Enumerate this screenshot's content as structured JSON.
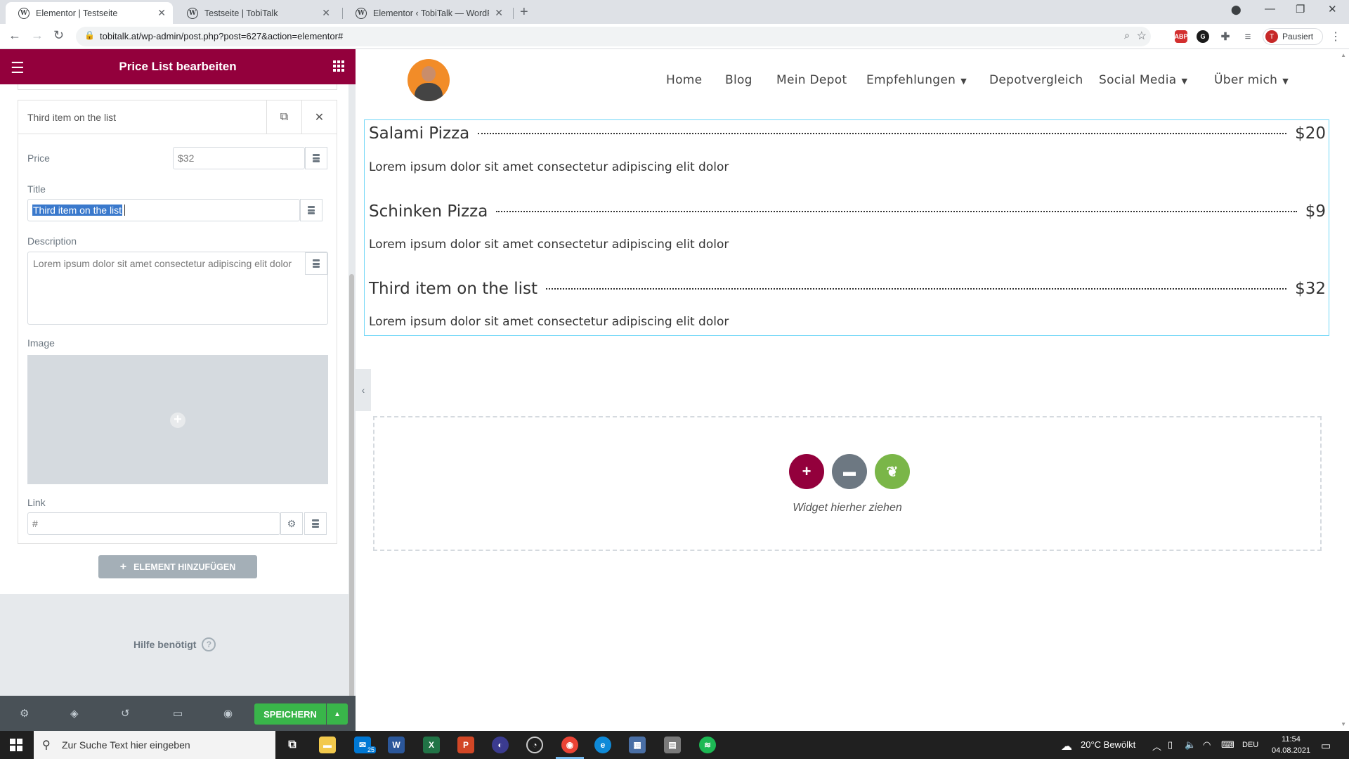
{
  "browser": {
    "tabs": [
      {
        "label": "Elementor | Testseite",
        "active": true
      },
      {
        "label": "Testseite | TobiTalk",
        "active": false
      },
      {
        "label": "Elementor ‹ TobiTalk — WordPre",
        "active": false
      }
    ],
    "url": "tobitalk.at/wp-admin/post.php?post=627&action=elementor#",
    "profile_label": "Pausiert",
    "profile_initial": "T",
    "ext_abp": "ABP"
  },
  "panel": {
    "title": "Price List bearbeiten",
    "item_title": "Third item on the list",
    "fields": {
      "price_label": "Price",
      "price_value": "$32",
      "title_label": "Title",
      "title_value": "Third item on the list",
      "description_label": "Description",
      "description_value": "Lorem ipsum dolor sit amet consectetur adipiscing elit dolor",
      "image_label": "Image",
      "link_label": "Link",
      "link_placeholder": "#"
    },
    "add_button": "ELEMENT HINZUFÜGEN",
    "help": "Hilfe benötigt",
    "save_button": "SPEICHERN"
  },
  "site": {
    "nav": [
      {
        "label": "Home",
        "dropdown": false
      },
      {
        "label": "Blog",
        "dropdown": false
      },
      {
        "label": "Mein Depot",
        "dropdown": false
      },
      {
        "label": "Empfehlungen",
        "dropdown": true
      },
      {
        "label": "Depotvergleich",
        "dropdown": false
      },
      {
        "label": "Social Media",
        "dropdown": true
      },
      {
        "label": "Über mich",
        "dropdown": true
      }
    ]
  },
  "price_list": [
    {
      "title": "Salami Pizza",
      "price": "$20",
      "description": "Lorem ipsum dolor sit amet consectetur adipiscing elit dolor"
    },
    {
      "title": "Schinken Pizza",
      "price": "$9",
      "description": "Lorem ipsum dolor sit amet consectetur adipiscing elit dolor"
    },
    {
      "title": "Third item on the list",
      "price": "$32",
      "description": "Lorem ipsum dolor sit amet consectetur adipiscing elit dolor"
    }
  ],
  "dropzone": {
    "label": "Widget hierher ziehen"
  },
  "colors": {
    "elementor_brand": "#93003c",
    "save_green": "#39b54a",
    "add_section": "#93003c",
    "template_grey": "#6d7882",
    "envato_green": "#7ab648"
  },
  "taskbar": {
    "search_placeholder": "Zur Suche Text hier eingeben",
    "mail_badge": "25",
    "weather": "20°C  Bewölkt",
    "lang": "DEU",
    "time": "11:54",
    "date": "04.08.2021"
  }
}
